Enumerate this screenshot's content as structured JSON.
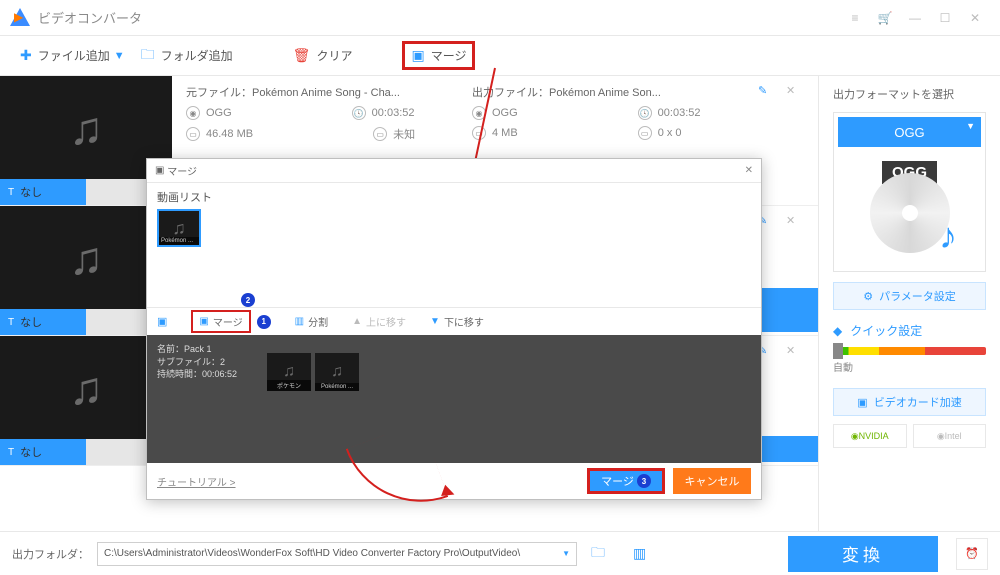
{
  "window": {
    "title": "ビデオコンバータ"
  },
  "toolbar": {
    "add_file": "ファイル追加",
    "add_folder": "フォルダ追加",
    "clear": "クリア",
    "merge": "マージ"
  },
  "queue": [
    {
      "thumb_label": "なし",
      "source_label": "元ファイル：",
      "source_name": "Pokémon Anime Song - Cha...",
      "output_label": "出力ファイル：",
      "output_name": "Pokémon Anime Son...",
      "format": "OGG",
      "duration": "00:03:52",
      "size": "46.48 MB",
      "status": "未知",
      "out_format": "OGG",
      "out_duration": "00:03:52",
      "out_size": "4 MB",
      "out_dim": "0 x 0"
    },
    {
      "thumb_label": "なし"
    },
    {
      "thumb_label": "なし"
    }
  ],
  "modal": {
    "title": "マージ",
    "video_list_label": "動画リスト",
    "video_thumb_caption": "Pokémon ...",
    "actions": {
      "merge": "マージ",
      "split": "分割",
      "up": "上に移す",
      "down": "下に移す"
    },
    "pack": {
      "name": "名前：Pack 1",
      "sub": "サブファイル：2",
      "dur": "持続時間：00:06:52",
      "t1": "ポケモン",
      "t2": "Pokémon ..."
    },
    "tutorial": "チュートリアル >",
    "merge_btn": "マージ",
    "cancel_btn": "キャンセル",
    "badge_1": "1",
    "badge_2": "2",
    "badge_3": "3"
  },
  "sidebar": {
    "select_format": "出力フォーマットを選択",
    "format": "OGG",
    "badge": "OGG",
    "params": "パラメータ設定",
    "quick": "クイック設定",
    "auto": "自動",
    "gpu": "ビデオカード加速",
    "nvidia": "NVIDIA",
    "intel": "Intel"
  },
  "footer": {
    "label": "出力フォルダ：",
    "path": "C:\\Users\\Administrator\\Videos\\WonderFox Soft\\HD Video Converter Factory Pro\\OutputVideo\\",
    "convert": "変換"
  }
}
